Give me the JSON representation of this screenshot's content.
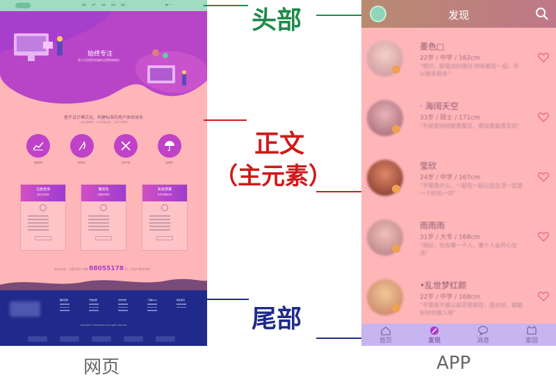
{
  "web": {
    "nav": [
      "首页",
      "关于",
      "案例",
      "新闻",
      "联系"
    ],
    "hero_title": "始终专注",
    "hero_subtitle": "致力为您提供卓越的品牌营销服务",
    "slogan": "基于设计模式化，构建标准的用户体验体系",
    "slogan_sub": "让设计更规范，让开发更高效，让用户更满意",
    "services": [
      "数据运营",
      "创意设计",
      "技术开发",
      "品牌推广"
    ],
    "cards": [
      {
        "title": "注册咨询",
        "subtitle": "提供专业服务"
      },
      {
        "title": "策划包",
        "subtitle": "全面策划服务"
      },
      {
        "title": "私有部署",
        "subtitle": "私有化部署方案"
      }
    ],
    "hotline_prefix": "来电咨询，已解决用户问题",
    "hotline_number": "88055178",
    "hotline_suffix": "次，为客户保驾护航！",
    "footer_cols": [
      "服务范围",
      "开发优势",
      "合作伙伴",
      "了解DSLA",
      "联系我们"
    ],
    "copyright": "Copyright © 2019 [DSLA] All rights reserved."
  },
  "annotations": {
    "header": "头部",
    "body_line1": "正文",
    "body_line2": "（主元素）",
    "footer": "尾部"
  },
  "captions": {
    "web": "网页",
    "app": "APP"
  },
  "app": {
    "title": "发现",
    "users": [
      {
        "name": "墨色□",
        "info": "22岁 / 中学 / 162cm",
        "desc": "“相识，即是对的缘分 所有都在一起，所以很多很多”"
      },
      {
        "name": "· 海阔天空",
        "info": "33岁 / 硕士 / 171cm",
        "desc": "“不经意间就被我看见，那就是最真实的”"
      },
      {
        "name": "莹欣",
        "info": "24岁 / 中学 / 167cm",
        "desc": "“不管是什么，一起在一起以后生活一定是一个好的一切”"
      },
      {
        "name": "雨雨雨",
        "info": "31岁 / 大专 / 168cm",
        "desc": "“很好，你去哪一个人，像个人会开心生活”"
      },
      {
        "name": "•乱世梦红颜",
        "info": "22岁 / 中学 / 168cm",
        "desc": "“不管是不是以前还是现在，面对也，都能好好的做人呀”"
      }
    ],
    "tabs": [
      "首页",
      "发现",
      "消息",
      "家园"
    ],
    "active_tab": "发现"
  }
}
